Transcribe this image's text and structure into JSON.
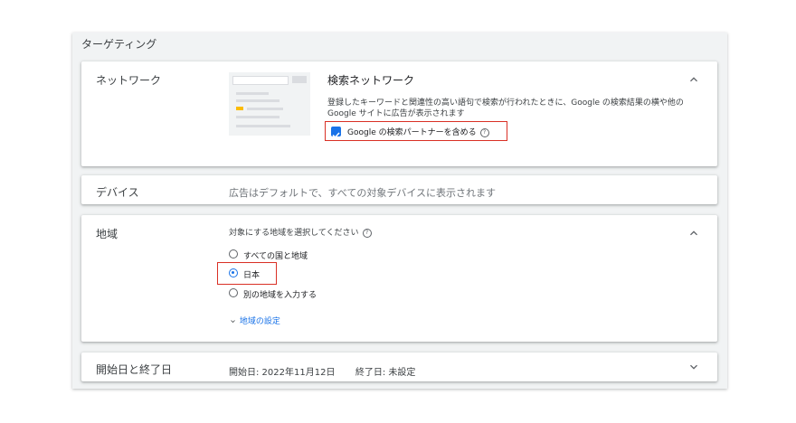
{
  "section": {
    "title": "ターゲティング"
  },
  "network": {
    "label": "ネットワーク",
    "title": "検索ネットワーク",
    "description": "登録したキーワードと関連性の高い語句で検索が行われたときに、Google の検索結果の横や他の Google サイトに広告が表示されます",
    "partner_checkbox_label": "Google の検索パートナーを含める",
    "partner_checked": true
  },
  "device": {
    "label": "デバイス",
    "text": "広告はデフォルトで、すべての対象デバイスに表示されます"
  },
  "region": {
    "label": "地域",
    "prompt": "対象にする地域を選択してください",
    "options": [
      {
        "label": "すべての国と地域",
        "selected": false
      },
      {
        "label": "日本",
        "selected": true
      },
      {
        "label": "別の地域を入力する",
        "selected": false
      }
    ],
    "settings_link": "地域の設定"
  },
  "dates": {
    "label": "開始日と終了日",
    "start": "開始日: 2022年11月12日",
    "end": "終了日: 未設定"
  },
  "icons": {
    "expand": "chevron-up-icon",
    "collapse": "chevron-down-icon",
    "help": "help-icon"
  },
  "colors": {
    "accent": "#1a73e8",
    "highlight": "#d93025"
  }
}
